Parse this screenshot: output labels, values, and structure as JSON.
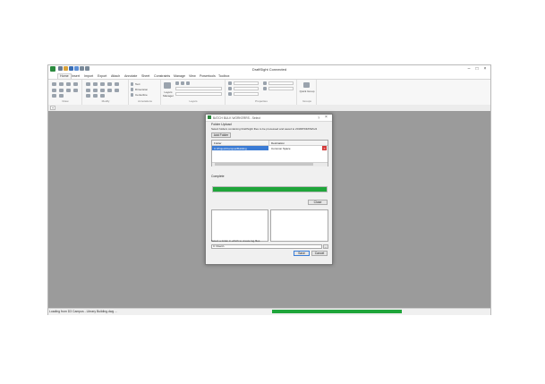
{
  "app": {
    "title": "DraftSight Connected",
    "tabs": [
      "Home",
      "Insert",
      "Import",
      "Export",
      "Attach",
      "Annotate",
      "Sheet",
      "Constraints",
      "Manage",
      "View",
      "Powertools",
      "Toolbox"
    ],
    "ribbon": {
      "groups": [
        "Draw",
        "Modify",
        "Annotations",
        "Layers",
        "Properties",
        "Groups"
      ],
      "annotations_items": [
        "Text",
        "Dimension",
        "Centerline"
      ],
      "layers_manager_label": "Layers Manager",
      "groups_label": "Quick Group"
    },
    "statusbar": {
      "text": "Loading from D3 Campus - Library Building.dwg ..."
    },
    "colors": {
      "progress": "#1fa53a",
      "canvas": "#9b9b9b"
    }
  },
  "dialog": {
    "title": "BATCH BULK WORKERRS - Select",
    "section_title": "Folder Upload",
    "instructions": "Select folders containing DraftSight files to be processed and saved to 2018/PDF/DWG/4",
    "add_folder_label": "Add Folder",
    "table": {
      "headers": [
        "Folder",
        "Destination"
      ],
      "rows": [
        {
          "folder": "C:\\Project\\Campus\\Building",
          "destination": "Common Space"
        }
      ]
    },
    "status_label": "Complete",
    "progress": 1.0,
    "close_label": "Close",
    "log_folder_label": "Select a folder in which to create log files",
    "log_folder_value": "C:\\Users\\",
    "browse_label": "...",
    "save_label": "Save",
    "cancel_label": "Cancel"
  }
}
